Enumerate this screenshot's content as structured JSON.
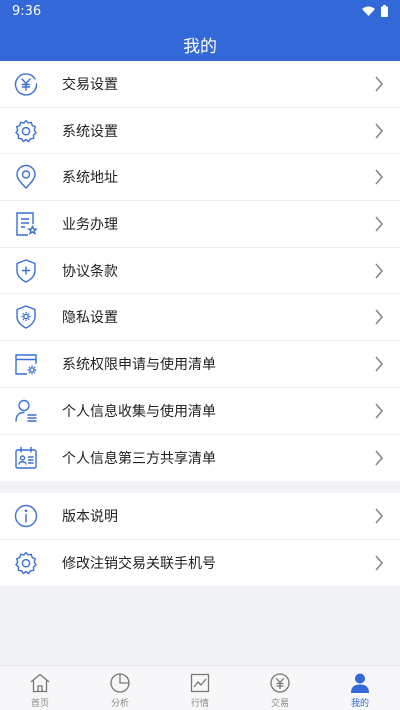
{
  "status_bar": {
    "time": "9:36"
  },
  "header": {
    "title": "我的"
  },
  "menu_group_1": [
    {
      "label": "交易设置",
      "icon": "yen-circle-icon"
    },
    {
      "label": "系统设置",
      "icon": "gear-icon"
    },
    {
      "label": "系统地址",
      "icon": "location-pin-icon"
    },
    {
      "label": "业务办理",
      "icon": "document-star-icon"
    },
    {
      "label": "协议条款",
      "icon": "shield-plus-icon"
    },
    {
      "label": "隐私设置",
      "icon": "shield-gear-icon"
    },
    {
      "label": "系统权限申请与使用清单",
      "icon": "window-gear-icon"
    },
    {
      "label": "个人信息收集与使用清单",
      "icon": "user-list-icon"
    },
    {
      "label": "个人信息第三方共享清单",
      "icon": "calendar-card-icon"
    }
  ],
  "menu_group_2": [
    {
      "label": "版本说明",
      "icon": "info-icon"
    },
    {
      "label": "修改注销交易关联手机号",
      "icon": "gear-icon"
    }
  ],
  "tabbar": [
    {
      "label": "首页",
      "icon": "home-icon"
    },
    {
      "label": "分析",
      "icon": "pie-chart-icon"
    },
    {
      "label": "行情",
      "icon": "line-chart-icon"
    },
    {
      "label": "交易",
      "icon": "yen-circle-icon"
    },
    {
      "label": "我的",
      "icon": "user-icon"
    }
  ],
  "colors": {
    "primary": "#3368d8",
    "icon_blue": "#3a6fd8",
    "background": "#f2f3f7"
  }
}
